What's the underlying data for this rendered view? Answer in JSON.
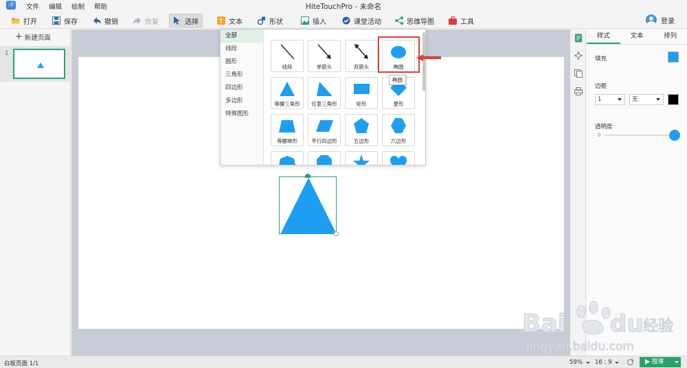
{
  "app": {
    "logo_text": "Ⓐ",
    "title": "HiteTouchPro - 未命名",
    "menu": [
      "文件",
      "编辑",
      "绘制",
      "帮助"
    ],
    "login_label": "登录"
  },
  "toolbar": {
    "open": "打开",
    "save": "保存",
    "undo": "撤销",
    "redo": "恢复",
    "select": "选择",
    "text": "文本",
    "shape": "形状",
    "insert": "插入",
    "class_activity": "课堂活动",
    "mindmap": "思维导图",
    "tools": "工具"
  },
  "pages": {
    "new_page": "新建页面",
    "current_number": "1"
  },
  "shape_panel": {
    "categories": [
      "全部",
      "线段",
      "圆形",
      "三角形",
      "四边形",
      "多边形",
      "特殊图形"
    ],
    "active_category": "全部",
    "shapes": [
      "线段",
      "单箭头",
      "双箭头",
      "椭圆",
      "等腰三角形",
      "任意三角形",
      "矩形",
      "菱形",
      "等腰梯形",
      "平行四边形",
      "五边形",
      "六边形"
    ],
    "highlighted": "椭圆",
    "tooltip": "椭圆"
  },
  "properties": {
    "tabs": [
      "样式",
      "文本",
      "排列"
    ],
    "active_tab": "样式",
    "fill_label": "填充",
    "fill_color": "#1e9ef1",
    "border_label": "边框",
    "border_width": "1",
    "border_style": "无",
    "border_color": "#000000",
    "opacity_label": "透明度",
    "opacity_value": "0"
  },
  "status": {
    "page_info": "白板页面 1/1",
    "zoom": "59%",
    "ratio": "16 : 9",
    "teach_label": "授课"
  },
  "colors": {
    "accent_green": "#2aa26a",
    "shape_blue": "#1e9ef1",
    "highlight_red": "#d9403a"
  },
  "watermark": {
    "brand": "Bai du 经验",
    "url": "jingyan.baidu.com"
  }
}
